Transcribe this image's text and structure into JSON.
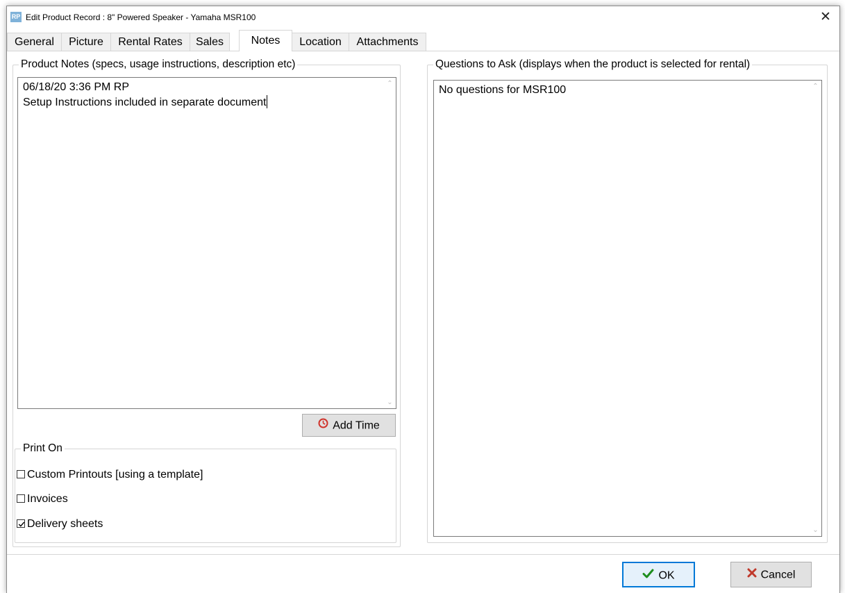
{
  "window": {
    "app_icon_text": "RP",
    "title": "Edit Product Record : 8\" Powered Speaker - Yamaha MSR100",
    "close_glyph": "✕"
  },
  "tabs": [
    {
      "label": "General",
      "active": false
    },
    {
      "label": "Picture",
      "active": false
    },
    {
      "label": "Rental Rates",
      "active": false
    },
    {
      "label": "Sales",
      "active": false
    },
    {
      "label": "Notes",
      "active": true
    },
    {
      "label": "Location",
      "active": false
    },
    {
      "label": "Attachments",
      "active": false
    }
  ],
  "product_notes": {
    "legend": "Product Notes (specs, usage instructions, description etc)",
    "lines": [
      "06/18/20 3:36 PM RP",
      "Setup Instructions included in separate document"
    ]
  },
  "add_time_button": {
    "label": "Add Time",
    "icon": "clock-icon"
  },
  "print_on": {
    "legend": "Print On",
    "options": [
      {
        "label": "Custom Printouts [using a template]",
        "checked": false
      },
      {
        "label": "Invoices",
        "checked": false
      },
      {
        "label": "Delivery sheets",
        "checked": true
      }
    ]
  },
  "questions": {
    "legend": "Questions to Ask (displays when the product is selected for rental)",
    "text": "No questions for MSR100"
  },
  "buttons": {
    "ok": {
      "label": "OK",
      "icon": "checkmark-icon",
      "icon_color": "#1e8e1e"
    },
    "cancel": {
      "label": "Cancel",
      "icon": "x-icon",
      "icon_color": "#c0392b"
    }
  },
  "colors": {
    "app_icon": "#7fb2d9",
    "ok_border": "#0078d7",
    "ok_bg": "#e5f1fb",
    "clock_icon": "#d0342c"
  }
}
